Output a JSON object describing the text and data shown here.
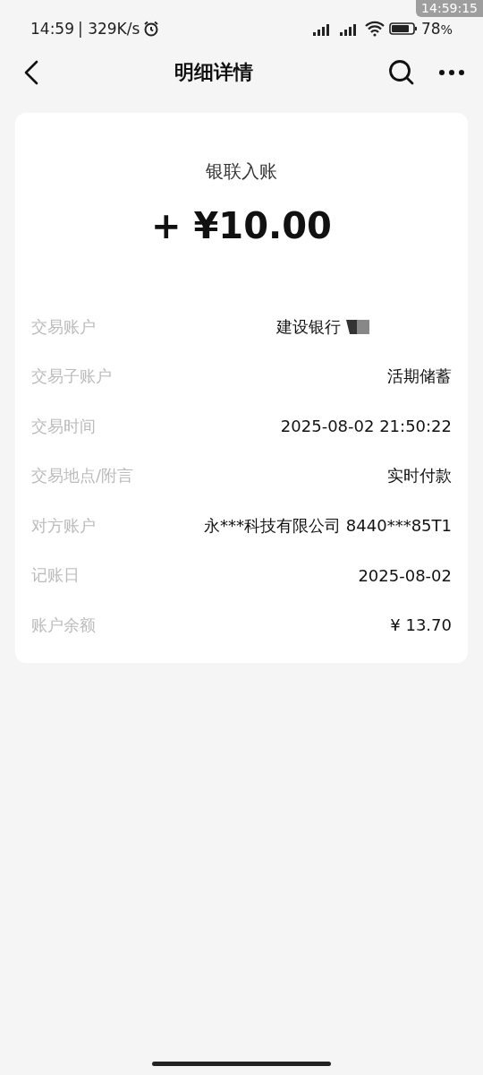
{
  "status_bar": {
    "time": "14:59",
    "speed": "| 329K/s",
    "battery": "78",
    "battery_unit": "%",
    "overlay_clock": "14:59:15"
  },
  "nav": {
    "title": "明细详情"
  },
  "summary": {
    "type": "银联入账",
    "amount": "+ ¥10.00"
  },
  "rows": [
    {
      "label": "交易账户",
      "value": "建设银行",
      "kind": "redacted"
    },
    {
      "label": "交易子账户",
      "value": "活期储蓄",
      "kind": "plain"
    },
    {
      "label": "交易时间",
      "value": "2025-08-02 21:50:22",
      "kind": "plain"
    },
    {
      "label": "交易地点/附言",
      "value": "实时付款",
      "kind": "plain"
    },
    {
      "label": "对方账户",
      "value": "永***科技有限公司 8440***85T1",
      "kind": "plain"
    },
    {
      "label": "记账日",
      "value": "2025-08-02",
      "kind": "plain"
    },
    {
      "label": "账户余额",
      "value": "¥ 13.70",
      "kind": "plain"
    }
  ]
}
